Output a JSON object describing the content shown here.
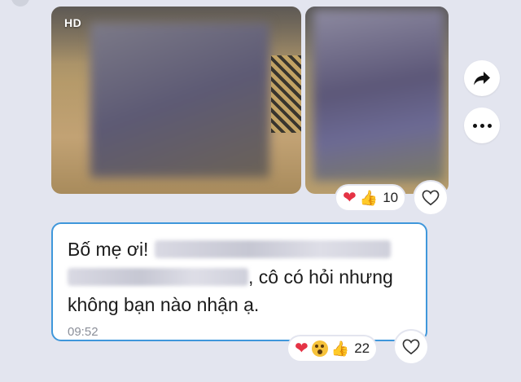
{
  "photos": {
    "hd_badge": "HD",
    "reactions": {
      "heart": "❤",
      "thumbs": "👍",
      "count": "10"
    }
  },
  "message": {
    "line1_text": "Bố mẹ ơi!",
    "line2_text": ", cô có hỏi nhưng",
    "line3_text": "không bạn nào nhận ạ.",
    "time": "09:52",
    "reactions": {
      "heart": "❤",
      "thumbs": "👍",
      "count": "22"
    }
  },
  "colors": {
    "background": "#e3e5ef",
    "bubble_border": "#3f97db",
    "heart": "#e53345"
  },
  "icons": [
    "forward-icon",
    "more-options-icon",
    "heart-outline-icon",
    "heart-emoji-icon",
    "thumbs-up-emoji-icon",
    "astonished-emoji-icon"
  ]
}
